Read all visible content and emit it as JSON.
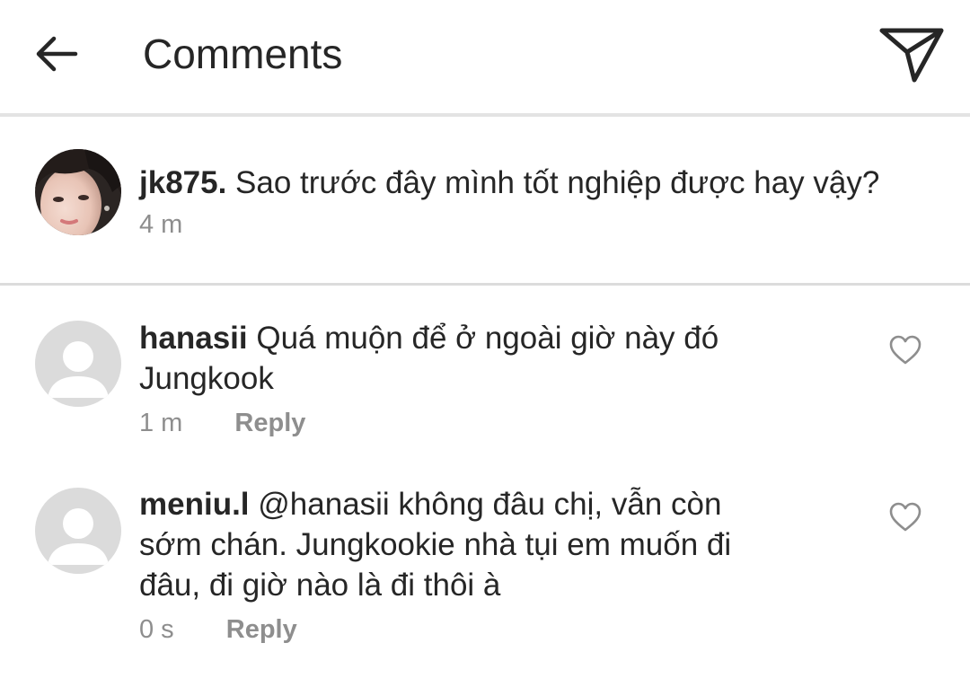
{
  "header": {
    "title": "Comments",
    "back_icon": "arrow-left-icon",
    "send_icon": "paper-plane-icon"
  },
  "caption": {
    "username": "jk875.",
    "text": "Sao trước đây mình tốt nghiệp được hay vậy?",
    "time": "4 m"
  },
  "comments": [
    {
      "username": "hanasii",
      "lines": [
        "Quá muộn để ở ngoài giờ này đó",
        "Jungkook"
      ],
      "time": "1 m",
      "reply_label": "Reply"
    },
    {
      "username": "meniu.l",
      "lines": [
        "@hanasii không đâu chị, vẫn còn",
        "sớm chán. Jungkookie nhà tụi em muốn đi",
        "đâu, đi giờ nào là đi thôi à"
      ],
      "time": "0 s",
      "reply_label": "Reply"
    }
  ],
  "colors": {
    "text": "#262626",
    "secondary": "#8e8e8e",
    "divider": "#dbdbdb",
    "avatar_placeholder": "#dbdbdb"
  }
}
